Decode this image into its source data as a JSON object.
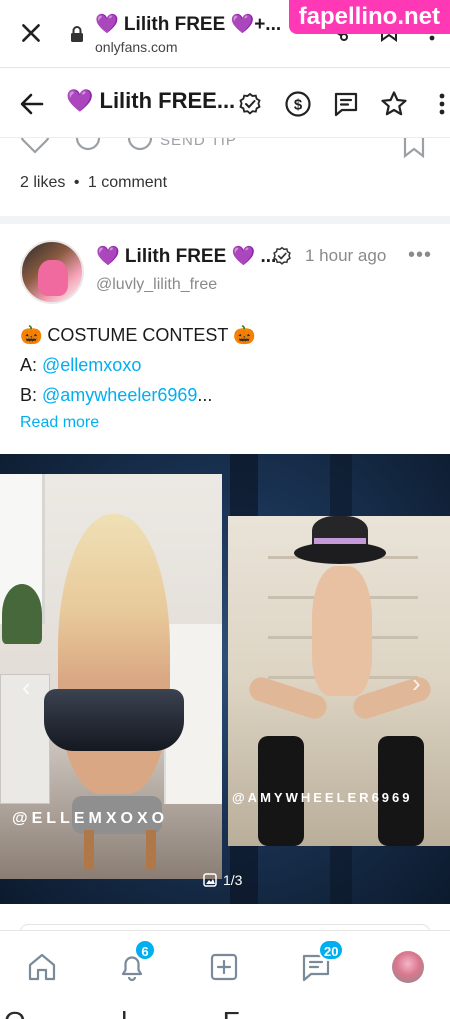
{
  "browser": {
    "title": "💜 Lilith FREE 💜+...",
    "url": "onlyfans.com"
  },
  "watermark": "fapellino.net",
  "header": {
    "title": "💜 Lilith FREE..."
  },
  "previous_post": {
    "send_tip_label": "SEND TIP",
    "likes": "2 likes",
    "dot": "•",
    "comments": "1 comment"
  },
  "post": {
    "author_name": "💜 Lilith FREE 💜 ...",
    "time": "1 hour ago",
    "more": "•••",
    "handle": "@luvly_lilith_free",
    "line1": "🎃 COSTUME CONTEST 🎃",
    "line2_prefix": "A: ",
    "line2_mention": "@ellemxoxo",
    "line3_prefix": "B: ",
    "line3_mention": "@amywheeler6969",
    "line3_suffix": "...",
    "read_more": "Read more",
    "media": {
      "left_watermark": "@ELLEMXOXO",
      "right_watermark": "@AMYWHEELER6969",
      "counter": "1/3"
    }
  },
  "bottom_nav": {
    "notifications_badge": "6",
    "messages_badge": "20"
  },
  "bottom_cut_text": "O . l . F . . . . / . . . . . . l"
}
